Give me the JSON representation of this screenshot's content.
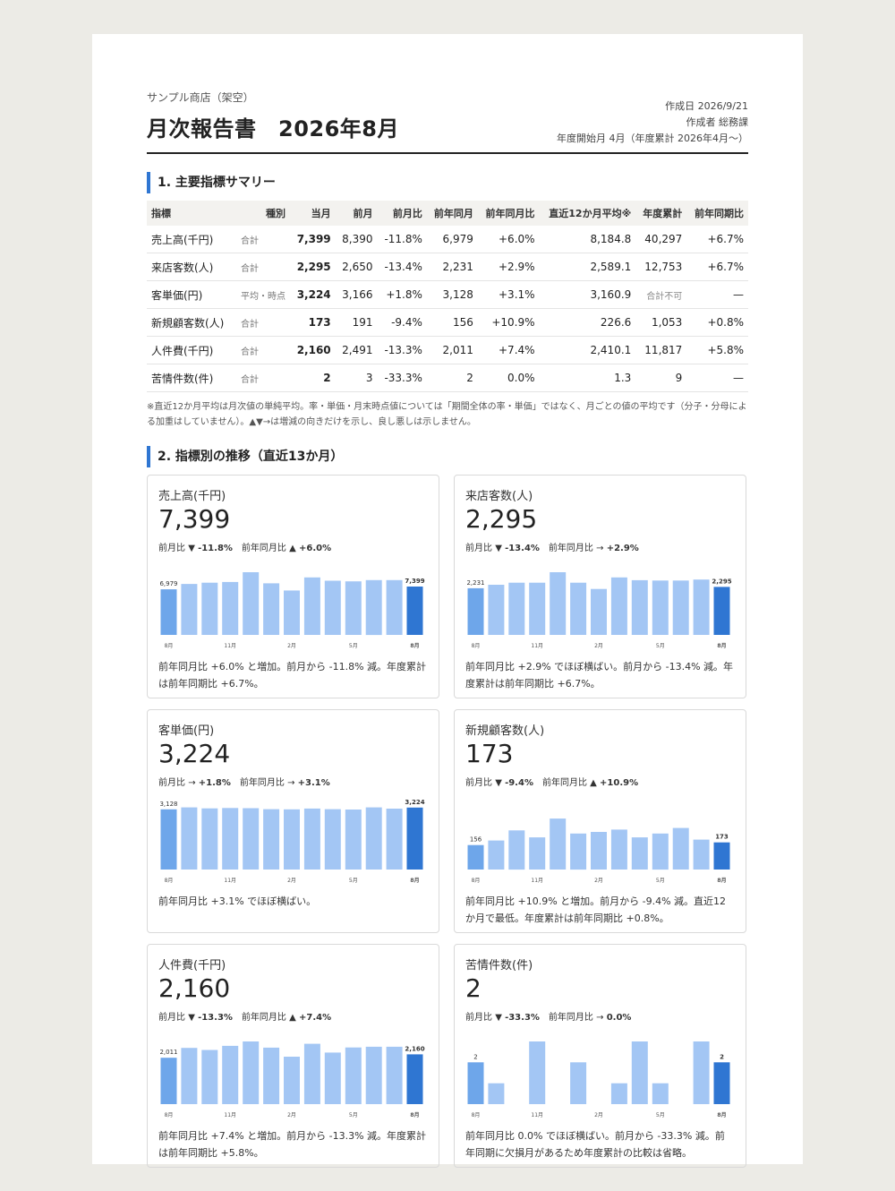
{
  "header": {
    "shop": "サンプル商店（架空）",
    "title": "月次報告書　2026年8月",
    "created": "作成日 2026/9/21",
    "author": "作成者 総務課",
    "fiscal": "年度開始月 4月（年度累計 2026年4月〜）"
  },
  "section1": {
    "title": "1. 主要指標サマリー"
  },
  "table": {
    "headers": [
      "指標",
      "種別",
      "当月",
      "前月",
      "前月比",
      "前年同月",
      "前年同月比",
      "直近12か月平均※",
      "年度累計",
      "前年同期比"
    ],
    "rows": [
      [
        "売上高(千円)",
        "合計",
        "7,399",
        "8,390",
        "-11.8%",
        "6,979",
        "+6.0%",
        "8,184.8",
        "40,297",
        "+6.7%"
      ],
      [
        "来店客数(人)",
        "合計",
        "2,295",
        "2,650",
        "-13.4%",
        "2,231",
        "+2.9%",
        "2,589.1",
        "12,753",
        "+6.7%"
      ],
      [
        "客単価(円)",
        "平均・時点",
        "3,224",
        "3,166",
        "+1.8%",
        "3,128",
        "+3.1%",
        "3,160.9",
        "合計不可",
        "—"
      ],
      [
        "新規顧客数(人)",
        "合計",
        "173",
        "191",
        "-9.4%",
        "156",
        "+10.9%",
        "226.6",
        "1,053",
        "+0.8%"
      ],
      [
        "人件費(千円)",
        "合計",
        "2,160",
        "2,491",
        "-13.3%",
        "2,011",
        "+7.4%",
        "2,410.1",
        "11,817",
        "+5.8%"
      ],
      [
        "苦情件数(件)",
        "合計",
        "2",
        "3",
        "-33.3%",
        "2",
        "0.0%",
        "1.3",
        "9",
        "—"
      ]
    ],
    "note": "※直近12か月平均は月次値の単純平均。率・単価・月末時点値については「期間全体の率・単価」ではなく、月ごとの値の平均です（分子・分母による加重はしていません）。▲▼→は増減の向きだけを示し、良し悪しは示しません。"
  },
  "section2": {
    "title": "2. 指標別の推移（直近13か月）"
  },
  "cards": [
    {
      "title": "売上高(千円)",
      "value": "7,399",
      "mom_label": "前月比",
      "mom_arrow": "▼",
      "mom": "-11.8%",
      "yoy_label": "前年同月比",
      "yoy_arrow": "▲",
      "yoy": "+6.0%",
      "comment": "前年同月比 +6.0% と増加。前月から -11.8% 減。年度累計は前年同期比 +6.7%。",
      "chart_data": {
        "type": "bar",
        "categories": [
          "8月",
          "9月",
          "10月",
          "11月",
          "12月",
          "1月",
          "2月",
          "3月",
          "4月",
          "5月",
          "6月",
          "7月",
          "8月"
        ],
        "values": [
          6979,
          7800,
          8000,
          8100,
          9600,
          7900,
          6800,
          8800,
          8300,
          8200,
          8400,
          8390,
          7399
        ],
        "tick_labels": [
          "8月",
          "11月",
          "2月",
          "5月",
          "8月"
        ],
        "first_label": "6,979",
        "last_label": "7,399",
        "ylim": [
          0,
          9600
        ]
      }
    },
    {
      "title": "来店客数(人)",
      "value": "2,295",
      "mom_label": "前月比",
      "mom_arrow": "▼",
      "mom": "-13.4%",
      "yoy_label": "前年同月比",
      "yoy_arrow": "→",
      "yoy": "+2.9%",
      "comment": "前年同月比 +2.9% でほぼ横ばい。前月から -13.4% 減。年度累計は前年同期比 +6.7%。",
      "chart_data": {
        "type": "bar",
        "categories": [
          "8月",
          "9月",
          "10月",
          "11月",
          "12月",
          "1月",
          "2月",
          "3月",
          "4月",
          "5月",
          "6月",
          "7月",
          "8月"
        ],
        "values": [
          2231,
          2400,
          2500,
          2500,
          3000,
          2500,
          2200,
          2750,
          2620,
          2600,
          2600,
          2650,
          2295
        ],
        "tick_labels": [
          "8月",
          "11月",
          "2月",
          "5月",
          "8月"
        ],
        "first_label": "2,231",
        "last_label": "2,295",
        "ylim": [
          0,
          3000
        ]
      }
    },
    {
      "title": "客単価(円)",
      "value": "3,224",
      "mom_label": "前月比",
      "mom_arrow": "→",
      "mom": "+1.8%",
      "yoy_label": "前年同月比",
      "yoy_arrow": "→",
      "yoy": "+3.1%",
      "comment": "前年同月比 +3.1% でほぼ横ばい。",
      "chart_data": {
        "type": "bar",
        "categories": [
          "8月",
          "9月",
          "10月",
          "11月",
          "12月",
          "1月",
          "2月",
          "3月",
          "4月",
          "5月",
          "6月",
          "7月",
          "8月"
        ],
        "values": [
          3128,
          3230,
          3180,
          3200,
          3190,
          3140,
          3130,
          3170,
          3140,
          3120,
          3230,
          3166,
          3224
        ],
        "tick_labels": [
          "8月",
          "11月",
          "2月",
          "5月",
          "8月"
        ],
        "first_label": "3,128",
        "last_label": "3,224",
        "ylim": [
          0,
          3260
        ]
      }
    },
    {
      "title": "新規顧客数(人)",
      "value": "173",
      "mom_label": "前月比",
      "mom_arrow": "▼",
      "mom": "-9.4%",
      "yoy_label": "前年同月比",
      "yoy_arrow": "▲",
      "yoy": "+10.9%",
      "comment": "前年同月比 +10.9% と増加。前月から -9.4% 減。直近12か月で最低。年度累計は前年同期比 +0.8%。",
      "chart_data": {
        "type": "bar",
        "categories": [
          "8月",
          "9月",
          "10月",
          "11月",
          "12月",
          "1月",
          "2月",
          "3月",
          "4月",
          "5月",
          "6月",
          "7月",
          "8月"
        ],
        "values": [
          156,
          185,
          250,
          205,
          325,
          230,
          240,
          255,
          205,
          230,
          265,
          191,
          173
        ],
        "tick_labels": [
          "8月",
          "11月",
          "2月",
          "5月",
          "8月"
        ],
        "first_label": "156",
        "last_label": "173",
        "ylim": [
          0,
          400
        ]
      }
    },
    {
      "title": "人件費(千円)",
      "value": "2,160",
      "mom_label": "前月比",
      "mom_arrow": "▼",
      "mom": "-13.3%",
      "yoy_label": "前年同月比",
      "yoy_arrow": "▲",
      "yoy": "+7.4%",
      "comment": "前年同月比 +7.4% と増加。前月から -13.3% 減。年度累計は前年同期比 +5.8%。",
      "chart_data": {
        "type": "bar",
        "categories": [
          "8月",
          "9月",
          "10月",
          "11月",
          "12月",
          "1月",
          "2月",
          "3月",
          "4月",
          "5月",
          "6月",
          "7月",
          "8月"
        ],
        "values": [
          2011,
          2440,
          2350,
          2530,
          2720,
          2450,
          2060,
          2620,
          2240,
          2460,
          2490,
          2491,
          2160
        ],
        "tick_labels": [
          "8月",
          "11月",
          "2月",
          "5月",
          "8月"
        ],
        "first_label": "2,011",
        "last_label": "2,160",
        "ylim": [
          0,
          2720
        ]
      }
    },
    {
      "title": "苦情件数(件)",
      "value": "2",
      "mom_label": "前月比",
      "mom_arrow": "▼",
      "mom": "-33.3%",
      "yoy_label": "前年同月比",
      "yoy_arrow": "→",
      "yoy": "0.0%",
      "comment": "前年同月比 0.0% でほぼ横ばい。前月から -33.3% 減。前年同期に欠損月があるため年度累計の比較は省略。",
      "chart_data": {
        "type": "bar",
        "categories": [
          "8月",
          "9月",
          "10月",
          "11月",
          "12月",
          "1月",
          "2月",
          "3月",
          "4月",
          "5月",
          "6月",
          "7月",
          "8月"
        ],
        "values": [
          2,
          1,
          0,
          3,
          0,
          2,
          0,
          1,
          3,
          1,
          0,
          3,
          2
        ],
        "tick_labels": [
          "8月",
          "11月",
          "2月",
          "5月",
          "8月"
        ],
        "first_label": "2",
        "last_label": "2",
        "ylim": [
          0,
          3
        ]
      }
    }
  ],
  "colors": {
    "accent": "#2f76d2",
    "bar_first": "#6ea6ea",
    "bar": "#a3c6f4",
    "bar_current": "#2f76d2"
  }
}
